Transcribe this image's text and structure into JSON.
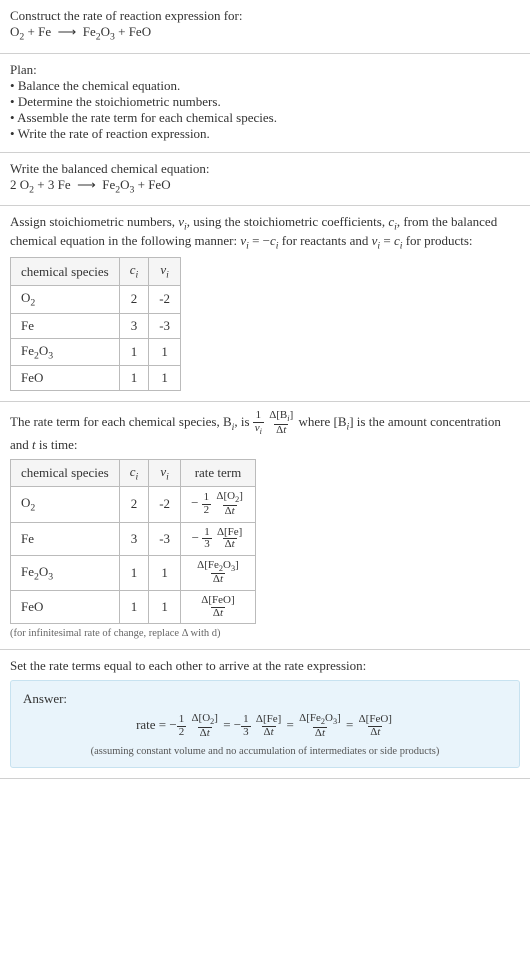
{
  "header": {
    "title": "Construct the rate of reaction expression for:",
    "equation_html": "O<sub>2</sub> + Fe &nbsp;⟶&nbsp; Fe<sub>2</sub>O<sub>3</sub> + FeO"
  },
  "plan": {
    "title": "Plan:",
    "items": [
      "Balance the chemical equation.",
      "Determine the stoichiometric numbers.",
      "Assemble the rate term for each chemical species.",
      "Write the rate of reaction expression."
    ]
  },
  "balanced": {
    "title": "Write the balanced chemical equation:",
    "equation_html": "2 O<sub>2</sub> + 3 Fe &nbsp;⟶&nbsp; Fe<sub>2</sub>O<sub>3</sub> + FeO"
  },
  "stoich": {
    "intro_html": "Assign stoichiometric numbers, <i>ν<sub>i</sub></i>, using the stoichiometric coefficients, <i>c<sub>i</sub></i>, from the balanced chemical equation in the following manner: <i>ν<sub>i</sub></i> = −<i>c<sub>i</sub></i> for reactants and <i>ν<sub>i</sub></i> = <i>c<sub>i</sub></i> for products:",
    "headers": [
      "chemical species",
      "c_i",
      "ν_i"
    ],
    "header_html": [
      "chemical species",
      "<i>c<sub>i</sub></i>",
      "<i>ν<sub>i</sub></i>"
    ],
    "rows": [
      {
        "species_html": "O<sub>2</sub>",
        "c": "2",
        "nu": "-2"
      },
      {
        "species_html": "Fe",
        "c": "3",
        "nu": "-3"
      },
      {
        "species_html": "Fe<sub>2</sub>O<sub>3</sub>",
        "c": "1",
        "nu": "1"
      },
      {
        "species_html": "FeO",
        "c": "1",
        "nu": "1"
      }
    ]
  },
  "rate_terms": {
    "intro_pre": "The rate term for each chemical species, B",
    "intro_mid": ", is ",
    "intro_post_html": " where [B<sub><i>i</i></sub>] is the amount concentration and <i>t</i> is time:",
    "headers": [
      "chemical species",
      "c_i",
      "ν_i",
      "rate term"
    ],
    "header_html": [
      "chemical species",
      "<i>c<sub>i</sub></i>",
      "<i>ν<sub>i</sub></i>",
      "rate term"
    ],
    "rows": [
      {
        "species_html": "O<sub>2</sub>",
        "c": "2",
        "nu": "-2",
        "rate_prefix": "−",
        "rate_num1": "1",
        "rate_den1": "2",
        "rate_num2": "Δ[O<sub>2</sub>]",
        "rate_den2": "Δ<i>t</i>"
      },
      {
        "species_html": "Fe",
        "c": "3",
        "nu": "-3",
        "rate_prefix": "−",
        "rate_num1": "1",
        "rate_den1": "3",
        "rate_num2": "Δ[Fe]",
        "rate_den2": "Δ<i>t</i>"
      },
      {
        "species_html": "Fe<sub>2</sub>O<sub>3</sub>",
        "c": "1",
        "nu": "1",
        "rate_prefix": "",
        "rate_num1": "",
        "rate_den1": "",
        "rate_num2": "Δ[Fe<sub>2</sub>O<sub>3</sub>]",
        "rate_den2": "Δ<i>t</i>"
      },
      {
        "species_html": "FeO",
        "c": "1",
        "nu": "1",
        "rate_prefix": "",
        "rate_num1": "",
        "rate_den1": "",
        "rate_num2": "Δ[FeO]",
        "rate_den2": "Δ<i>t</i>"
      }
    ],
    "note": "(for infinitesimal rate of change, replace Δ with d)"
  },
  "final": {
    "title": "Set the rate terms equal to each other to arrive at the rate expression:",
    "answer_label": "Answer:",
    "rate_label": "rate = ",
    "note": "(assuming constant volume and no accumulation of intermediates or side products)"
  }
}
